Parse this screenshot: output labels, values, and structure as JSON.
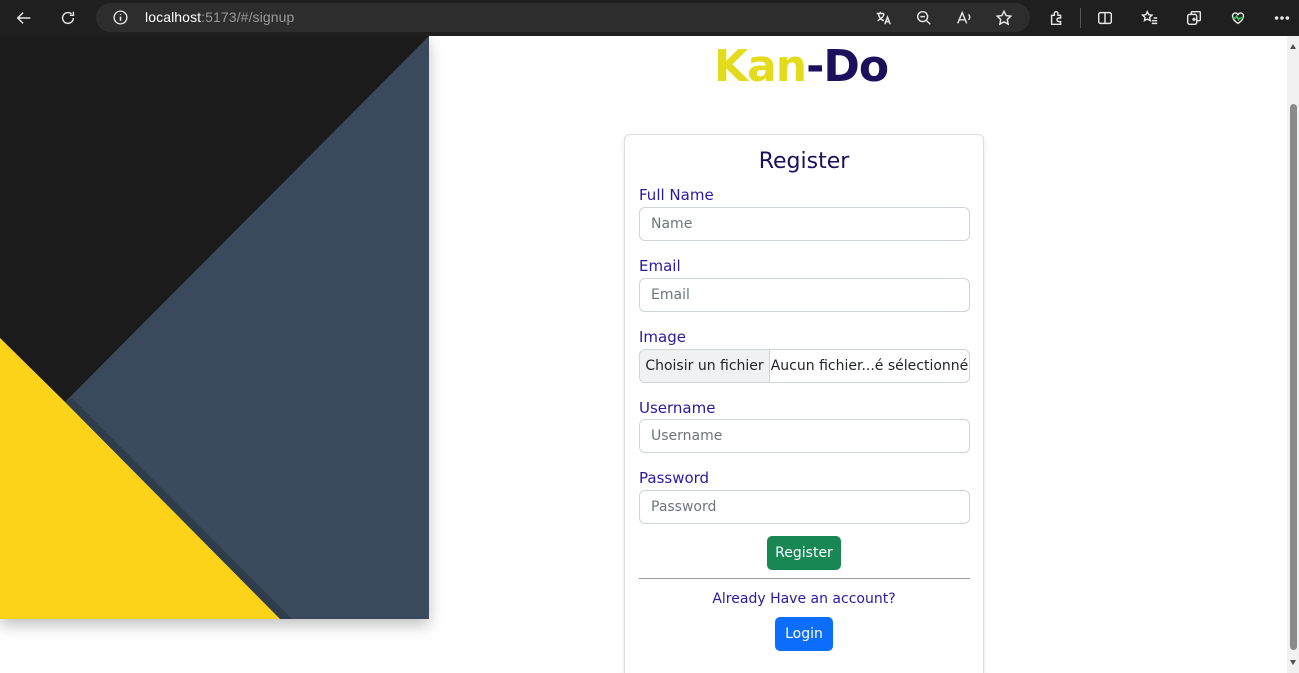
{
  "browser": {
    "url_host": "localhost",
    "url_path": ":5173/#/signup"
  },
  "logo": {
    "part1": "Kan",
    "part2": "-Do"
  },
  "form": {
    "title": "Register",
    "fullname_label": "Full Name",
    "fullname_placeholder": "Name",
    "email_label": "Email",
    "email_placeholder": "Email",
    "image_label": "Image",
    "file_choose": "Choisir un fichier",
    "file_none": "Aucun fichier...é sélectionné",
    "username_label": "Username",
    "username_placeholder": "Username",
    "password_label": "Password",
    "password_placeholder": "Password",
    "register_button": "Register",
    "already_text": "Already Have an account?",
    "login_button": "Login"
  },
  "colors": {
    "accent_yellow": "#e2dc1c",
    "brand_navy": "#1c0f5c",
    "register_green": "#198754",
    "login_blue": "#0d6efd",
    "hero_dark": "#1b1b1b",
    "hero_slate": "#3a4a5c",
    "hero_yellow": "#fdd31a"
  }
}
